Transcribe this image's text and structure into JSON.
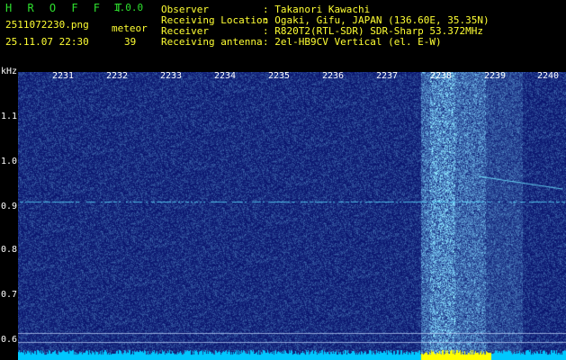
{
  "app": {
    "name": "H R O F F T",
    "version": "1.0.0"
  },
  "file": {
    "name": "2511072230.png",
    "timestamp": "25.11.07 22:30"
  },
  "meteor": {
    "label": "meteor",
    "count": "39"
  },
  "info": [
    {
      "key": "Observer",
      "value": ": Takanori Kawachi"
    },
    {
      "key": "Receiving Location",
      "value": ": Ogaki, Gifu, JAPAN (136.60E, 35.35N)"
    },
    {
      "key": "Receiver",
      "value": ": R820T2(RTL-SDR) SDR-Sharp 53.372MHz"
    },
    {
      "key": "Receiving antenna",
      "value": ": 2el-HB9CV Vertical (el. E-W)"
    }
  ],
  "axis": {
    "y_unit": "kHz",
    "y_ticks": [
      "1.1",
      "1.0",
      "0.9",
      "0.8",
      "0.7",
      "0.6"
    ],
    "x_ticks": [
      "2231",
      "2232",
      "2233",
      "2234",
      "2235",
      "2236",
      "2237",
      "2238",
      "2239",
      "2240"
    ]
  },
  "colors": {
    "title_green": "#2ee02e",
    "accent_yellow": "#ffff33",
    "bg": "#000000",
    "waterfall_base": "#001880"
  }
}
